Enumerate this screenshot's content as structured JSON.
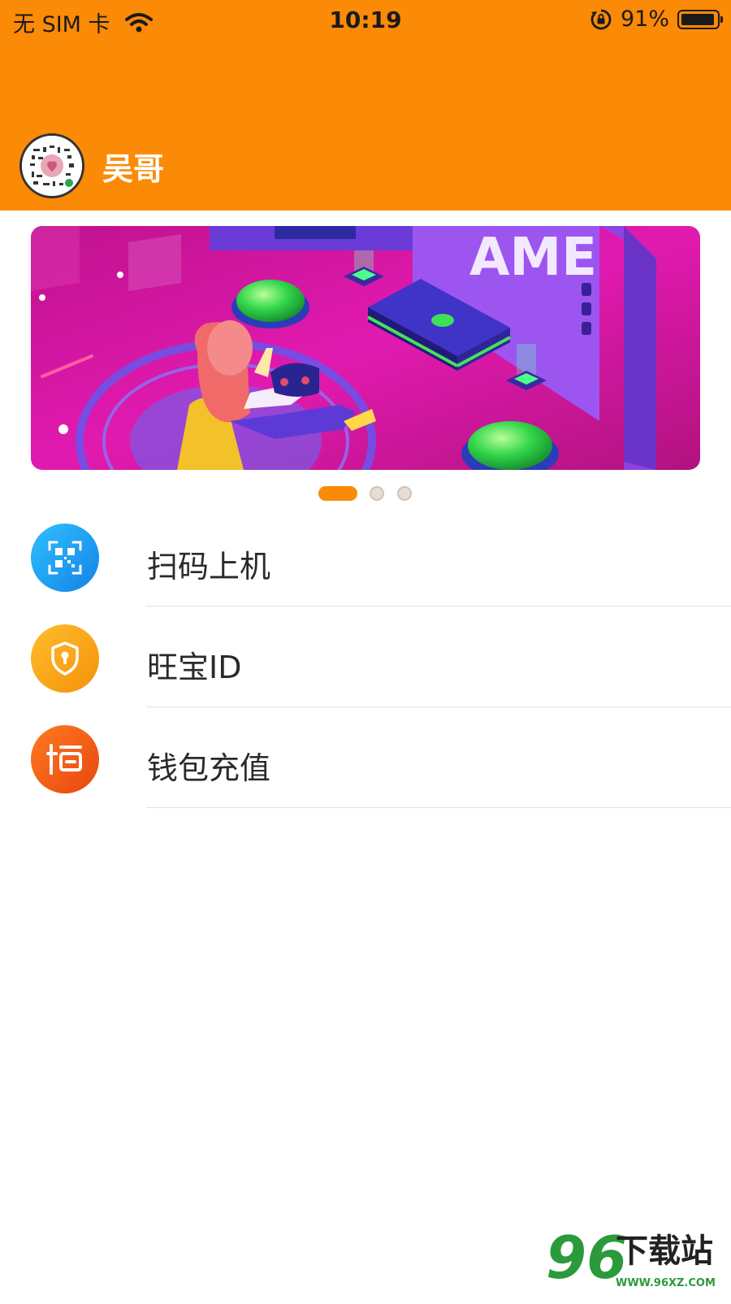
{
  "status_bar": {
    "carrier": "无 SIM 卡",
    "time": "10:19",
    "battery_percent": "91%",
    "battery_level": 0.91
  },
  "profile": {
    "username": "吴哥"
  },
  "banner": {
    "text": "AME",
    "page_count": 3,
    "active_page": 1
  },
  "menu": {
    "items": [
      {
        "label": "扫码上机",
        "icon": "qr-scan-icon",
        "color": "#1a9ef0"
      },
      {
        "label": "旺宝ID",
        "icon": "shield-keyhole-icon",
        "color": "#f8a40e"
      },
      {
        "label": "钱包充值",
        "icon": "wallet-recharge-icon",
        "color": "#f25a14"
      }
    ]
  },
  "watermark": {
    "digits": "96",
    "title": "下载站",
    "url": "WWW.96XZ.COM"
  },
  "colors": {
    "header": "#fb8a06",
    "accent": "#fb8a06"
  }
}
